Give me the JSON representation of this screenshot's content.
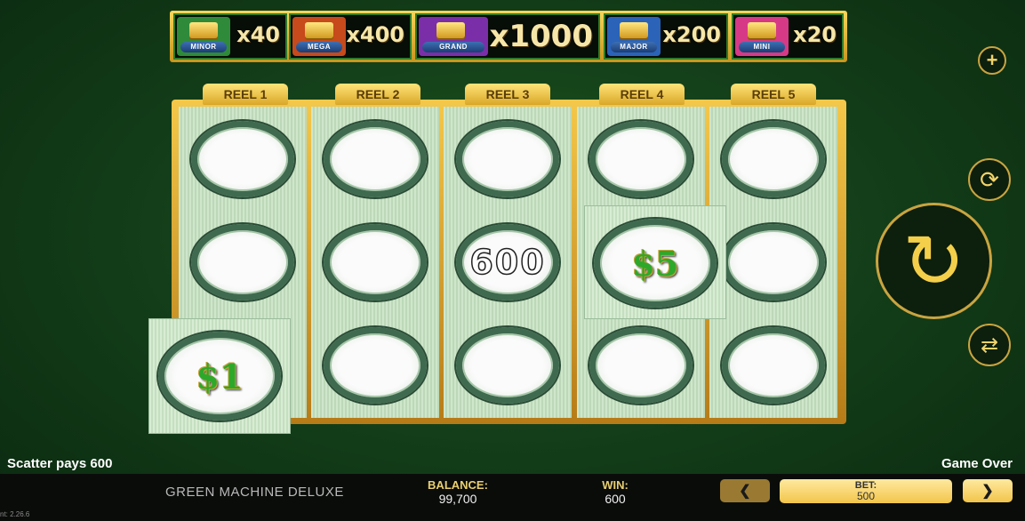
{
  "jackpots": [
    {
      "name": "MINOR",
      "multiplier": "x40",
      "color": "#2f8a3a"
    },
    {
      "name": "MEGA",
      "multiplier": "x400",
      "color": "#c64a1c"
    },
    {
      "name": "GRAND",
      "multiplier": "x1000",
      "color": "#7a2fa8"
    },
    {
      "name": "MAJOR",
      "multiplier": "x200",
      "color": "#2a63b8"
    },
    {
      "name": "MINI",
      "multiplier": "x20",
      "color": "#d63a86"
    }
  ],
  "reels": {
    "labels": [
      "REEL 1",
      "REEL 2",
      "REEL 3",
      "REEL 4",
      "REEL 5"
    ]
  },
  "symbols": {
    "scatter_value": "600",
    "reel4_prize": "$5",
    "reel1_prize": "$1"
  },
  "side_buttons": {
    "plus": "+",
    "autoplay": "⟳",
    "spin": "↻",
    "swap": "⇄"
  },
  "status": {
    "left": "Scatter pays 600",
    "right": "Game Over"
  },
  "bottom_bar": {
    "game_name": "GREEN MACHINE DELUXE",
    "balance_label": "BALANCE:",
    "balance_value": "99,700",
    "win_label": "WIN:",
    "win_value": "600",
    "prev_label": "❮",
    "next_label": "❯",
    "bet_label": "BET:",
    "bet_value": "500"
  },
  "version": "nt: 2.26.6",
  "colors": {
    "accent_gold": "#f2c54a",
    "felt_green": "#1f5a1c"
  }
}
